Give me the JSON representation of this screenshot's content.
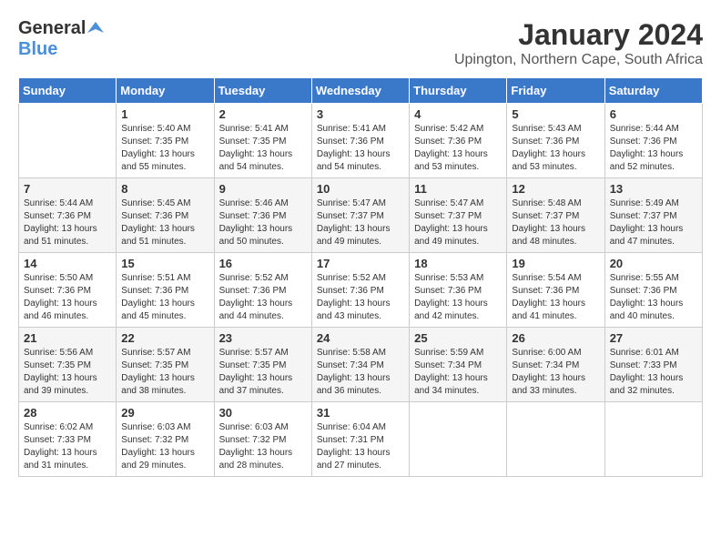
{
  "header": {
    "logo_general": "General",
    "logo_blue": "Blue",
    "month": "January 2024",
    "location": "Upington, Northern Cape, South Africa"
  },
  "weekdays": [
    "Sunday",
    "Monday",
    "Tuesday",
    "Wednesday",
    "Thursday",
    "Friday",
    "Saturday"
  ],
  "weeks": [
    [
      {
        "day": "",
        "sunrise": "",
        "sunset": "",
        "daylight": ""
      },
      {
        "day": "1",
        "sunrise": "Sunrise: 5:40 AM",
        "sunset": "Sunset: 7:35 PM",
        "daylight": "Daylight: 13 hours and 55 minutes."
      },
      {
        "day": "2",
        "sunrise": "Sunrise: 5:41 AM",
        "sunset": "Sunset: 7:35 PM",
        "daylight": "Daylight: 13 hours and 54 minutes."
      },
      {
        "day": "3",
        "sunrise": "Sunrise: 5:41 AM",
        "sunset": "Sunset: 7:36 PM",
        "daylight": "Daylight: 13 hours and 54 minutes."
      },
      {
        "day": "4",
        "sunrise": "Sunrise: 5:42 AM",
        "sunset": "Sunset: 7:36 PM",
        "daylight": "Daylight: 13 hours and 53 minutes."
      },
      {
        "day": "5",
        "sunrise": "Sunrise: 5:43 AM",
        "sunset": "Sunset: 7:36 PM",
        "daylight": "Daylight: 13 hours and 53 minutes."
      },
      {
        "day": "6",
        "sunrise": "Sunrise: 5:44 AM",
        "sunset": "Sunset: 7:36 PM",
        "daylight": "Daylight: 13 hours and 52 minutes."
      }
    ],
    [
      {
        "day": "7",
        "sunrise": "Sunrise: 5:44 AM",
        "sunset": "Sunset: 7:36 PM",
        "daylight": "Daylight: 13 hours and 51 minutes."
      },
      {
        "day": "8",
        "sunrise": "Sunrise: 5:45 AM",
        "sunset": "Sunset: 7:36 PM",
        "daylight": "Daylight: 13 hours and 51 minutes."
      },
      {
        "day": "9",
        "sunrise": "Sunrise: 5:46 AM",
        "sunset": "Sunset: 7:36 PM",
        "daylight": "Daylight: 13 hours and 50 minutes."
      },
      {
        "day": "10",
        "sunrise": "Sunrise: 5:47 AM",
        "sunset": "Sunset: 7:37 PM",
        "daylight": "Daylight: 13 hours and 49 minutes."
      },
      {
        "day": "11",
        "sunrise": "Sunrise: 5:47 AM",
        "sunset": "Sunset: 7:37 PM",
        "daylight": "Daylight: 13 hours and 49 minutes."
      },
      {
        "day": "12",
        "sunrise": "Sunrise: 5:48 AM",
        "sunset": "Sunset: 7:37 PM",
        "daylight": "Daylight: 13 hours and 48 minutes."
      },
      {
        "day": "13",
        "sunrise": "Sunrise: 5:49 AM",
        "sunset": "Sunset: 7:37 PM",
        "daylight": "Daylight: 13 hours and 47 minutes."
      }
    ],
    [
      {
        "day": "14",
        "sunrise": "Sunrise: 5:50 AM",
        "sunset": "Sunset: 7:36 PM",
        "daylight": "Daylight: 13 hours and 46 minutes."
      },
      {
        "day": "15",
        "sunrise": "Sunrise: 5:51 AM",
        "sunset": "Sunset: 7:36 PM",
        "daylight": "Daylight: 13 hours and 45 minutes."
      },
      {
        "day": "16",
        "sunrise": "Sunrise: 5:52 AM",
        "sunset": "Sunset: 7:36 PM",
        "daylight": "Daylight: 13 hours and 44 minutes."
      },
      {
        "day": "17",
        "sunrise": "Sunrise: 5:52 AM",
        "sunset": "Sunset: 7:36 PM",
        "daylight": "Daylight: 13 hours and 43 minutes."
      },
      {
        "day": "18",
        "sunrise": "Sunrise: 5:53 AM",
        "sunset": "Sunset: 7:36 PM",
        "daylight": "Daylight: 13 hours and 42 minutes."
      },
      {
        "day": "19",
        "sunrise": "Sunrise: 5:54 AM",
        "sunset": "Sunset: 7:36 PM",
        "daylight": "Daylight: 13 hours and 41 minutes."
      },
      {
        "day": "20",
        "sunrise": "Sunrise: 5:55 AM",
        "sunset": "Sunset: 7:36 PM",
        "daylight": "Daylight: 13 hours and 40 minutes."
      }
    ],
    [
      {
        "day": "21",
        "sunrise": "Sunrise: 5:56 AM",
        "sunset": "Sunset: 7:35 PM",
        "daylight": "Daylight: 13 hours and 39 minutes."
      },
      {
        "day": "22",
        "sunrise": "Sunrise: 5:57 AM",
        "sunset": "Sunset: 7:35 PM",
        "daylight": "Daylight: 13 hours and 38 minutes."
      },
      {
        "day": "23",
        "sunrise": "Sunrise: 5:57 AM",
        "sunset": "Sunset: 7:35 PM",
        "daylight": "Daylight: 13 hours and 37 minutes."
      },
      {
        "day": "24",
        "sunrise": "Sunrise: 5:58 AM",
        "sunset": "Sunset: 7:34 PM",
        "daylight": "Daylight: 13 hours and 36 minutes."
      },
      {
        "day": "25",
        "sunrise": "Sunrise: 5:59 AM",
        "sunset": "Sunset: 7:34 PM",
        "daylight": "Daylight: 13 hours and 34 minutes."
      },
      {
        "day": "26",
        "sunrise": "Sunrise: 6:00 AM",
        "sunset": "Sunset: 7:34 PM",
        "daylight": "Daylight: 13 hours and 33 minutes."
      },
      {
        "day": "27",
        "sunrise": "Sunrise: 6:01 AM",
        "sunset": "Sunset: 7:33 PM",
        "daylight": "Daylight: 13 hours and 32 minutes."
      }
    ],
    [
      {
        "day": "28",
        "sunrise": "Sunrise: 6:02 AM",
        "sunset": "Sunset: 7:33 PM",
        "daylight": "Daylight: 13 hours and 31 minutes."
      },
      {
        "day": "29",
        "sunrise": "Sunrise: 6:03 AM",
        "sunset": "Sunset: 7:32 PM",
        "daylight": "Daylight: 13 hours and 29 minutes."
      },
      {
        "day": "30",
        "sunrise": "Sunrise: 6:03 AM",
        "sunset": "Sunset: 7:32 PM",
        "daylight": "Daylight: 13 hours and 28 minutes."
      },
      {
        "day": "31",
        "sunrise": "Sunrise: 6:04 AM",
        "sunset": "Sunset: 7:31 PM",
        "daylight": "Daylight: 13 hours and 27 minutes."
      },
      {
        "day": "",
        "sunrise": "",
        "sunset": "",
        "daylight": ""
      },
      {
        "day": "",
        "sunrise": "",
        "sunset": "",
        "daylight": ""
      },
      {
        "day": "",
        "sunrise": "",
        "sunset": "",
        "daylight": ""
      }
    ]
  ]
}
